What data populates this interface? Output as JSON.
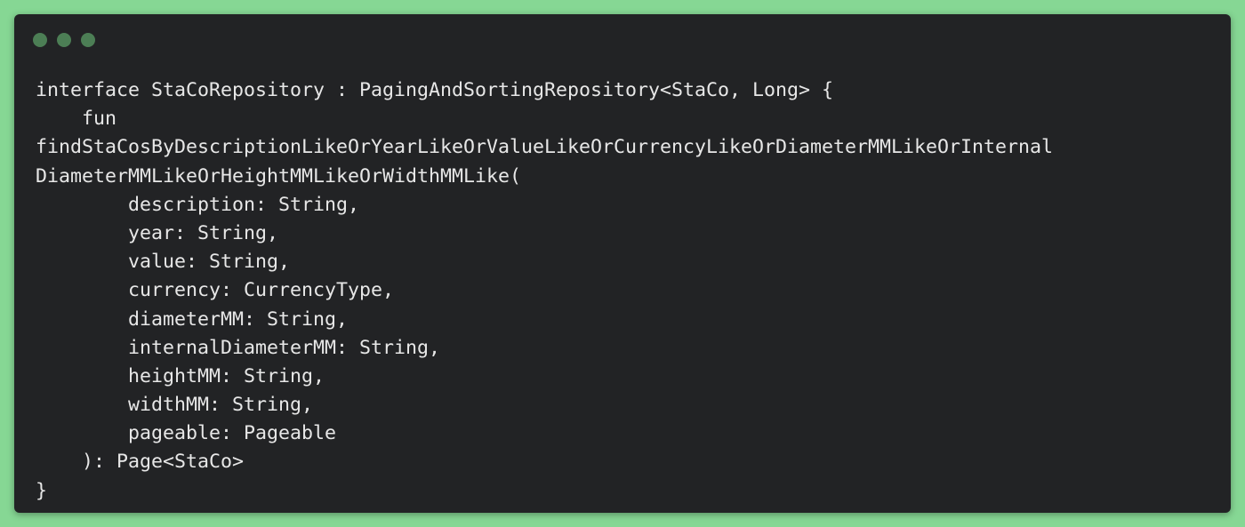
{
  "window": {
    "controls": [
      "window-dot-icon",
      "window-dot-icon",
      "window-dot-icon"
    ]
  },
  "code": {
    "lines": [
      "interface StaCoRepository : PagingAndSortingRepository<StaCo, Long> {",
      "    fun",
      "findStaCosByDescriptionLikeOrYearLikeOrValueLikeOrCurrencyLikeOrDiameterMMLikeOrInternal",
      "DiameterMMLikeOrHeightMMLikeOrWidthMMLike(",
      "        description: String,",
      "        year: String,",
      "        value: String,",
      "        currency: CurrencyType,",
      "        diameterMM: String,",
      "        internalDiameterMM: String,",
      "        heightMM: String,",
      "        widthMM: String,",
      "        pageable: Pageable",
      "    ): Page<StaCo>",
      "}"
    ]
  }
}
